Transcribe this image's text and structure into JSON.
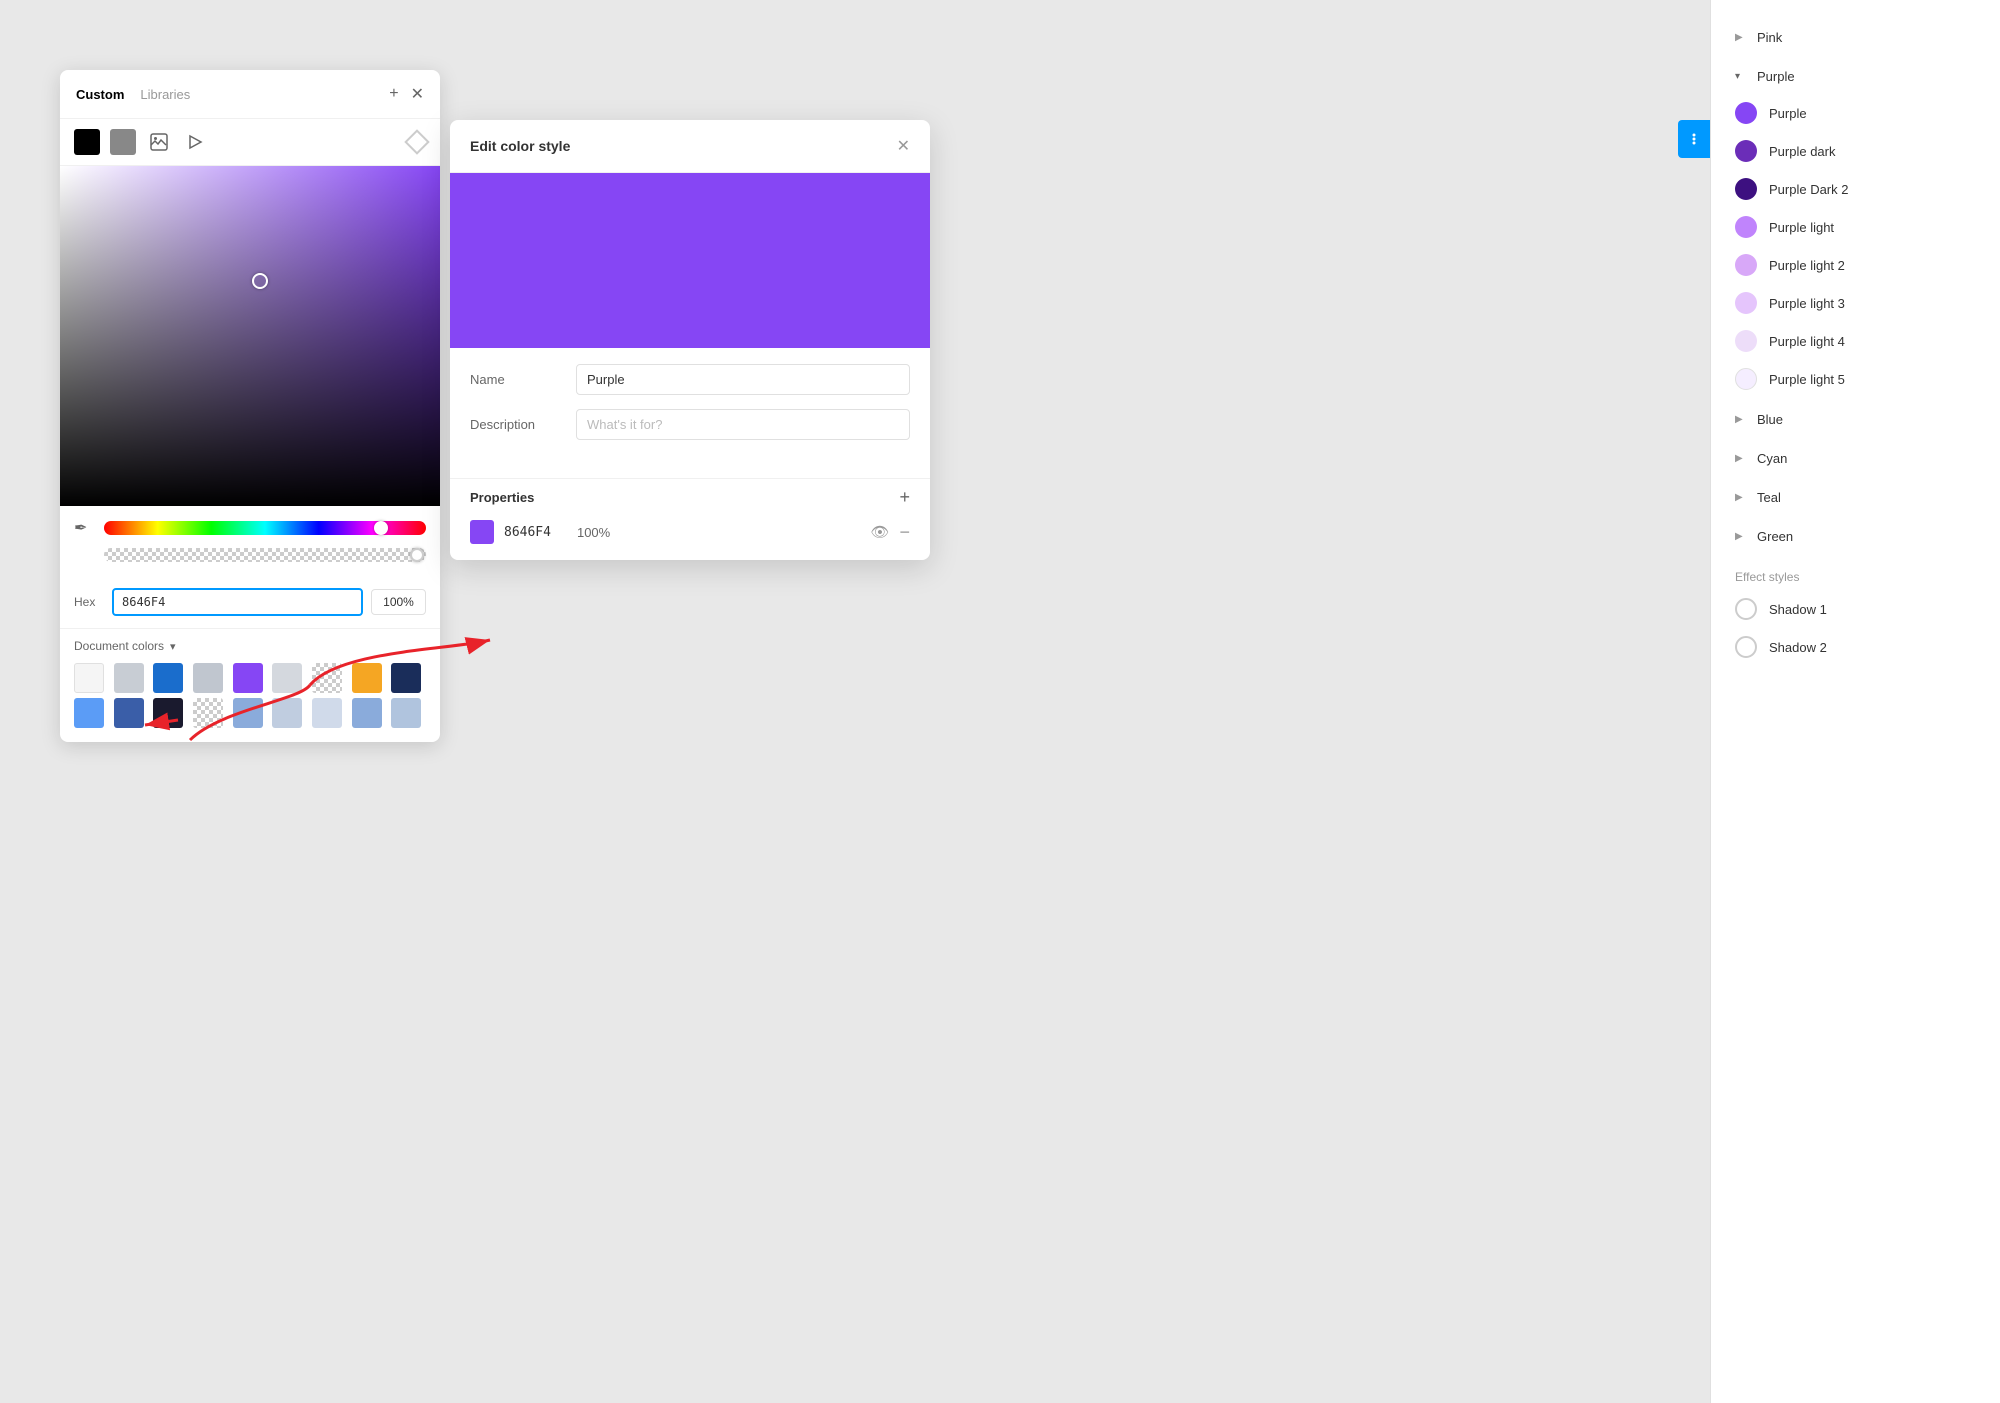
{
  "app": {
    "background": "#e8e8e8"
  },
  "colorPicker": {
    "tabs": {
      "custom": "Custom",
      "libraries": "Libraries"
    },
    "tools": {
      "black_swatch": "black",
      "gray_swatch": "gray"
    },
    "hexLabel": "Hex",
    "hexValue": "8646F4",
    "opacityValue": "100%",
    "docColorsLabel": "Document colors",
    "swatches": [
      {
        "color": "#f5f5f5"
      },
      {
        "color": "#c8cdd4"
      },
      {
        "color": "#1a6dcc"
      },
      {
        "color": "#c0c6cf"
      },
      {
        "color": "#8646F4"
      },
      {
        "color": "#d4d8de"
      },
      {
        "color": "#eee"
      },
      {
        "color": "#f5a623"
      },
      {
        "color": "#1a2d5a"
      },
      {
        "color": "#5b9cf6"
      },
      {
        "color": "#3a5ea8"
      },
      {
        "color": "#1a1a2e"
      },
      {
        "color": "#eee"
      },
      {
        "color": "#8aabdb"
      },
      {
        "color": "#c0cde0"
      },
      {
        "color": "#d0daea"
      },
      {
        "color": "#8aabdb"
      },
      {
        "color": "#b0c4de"
      }
    ]
  },
  "editModal": {
    "title": "Edit color style",
    "nameLabel": "Name",
    "nameValue": "Purple",
    "descriptionLabel": "Description",
    "descriptionPlaceholder": "What's it for?",
    "propertiesLabel": "Properties",
    "property": {
      "hex": "8646F4",
      "opacity": "100%"
    }
  },
  "sidebar": {
    "groups": [
      {
        "name": "Pink",
        "expanded": false,
        "items": []
      },
      {
        "name": "Purple",
        "expanded": true,
        "items": [
          {
            "name": "Purple",
            "color": "#8646F4"
          },
          {
            "name": "Purple dark",
            "color": "#6b2db8"
          },
          {
            "name": "Purple Dark 2",
            "color": "#3d1080"
          },
          {
            "name": "Purple light",
            "color": "#c084fc"
          },
          {
            "name": "Purple light 2",
            "color": "#d8a8f8"
          },
          {
            "name": "Purple light 3",
            "color": "#e5c5fc"
          },
          {
            "name": "Purple light 4",
            "color": "#edddf9"
          },
          {
            "name": "Purple light 5",
            "color": "#f5eeff"
          }
        ]
      },
      {
        "name": "Blue",
        "expanded": false,
        "items": []
      },
      {
        "name": "Cyan",
        "expanded": false,
        "items": []
      },
      {
        "name": "Teal",
        "expanded": false,
        "items": []
      },
      {
        "name": "Green",
        "expanded": false,
        "items": []
      }
    ],
    "effectStyles": {
      "label": "Effect styles",
      "items": [
        {
          "name": "Shadow 1"
        },
        {
          "name": "Shadow 2"
        }
      ]
    }
  }
}
